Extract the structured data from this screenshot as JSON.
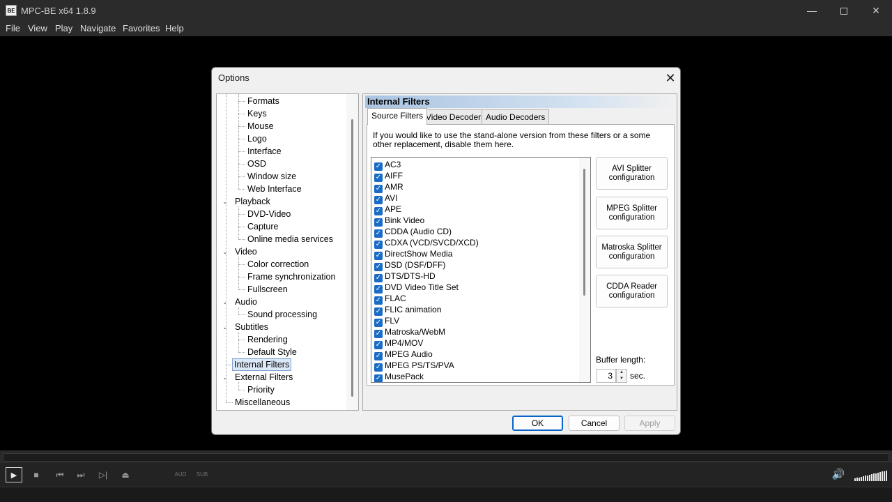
{
  "window": {
    "title": "MPC-BE x64 1.8.9",
    "icon_text": "BE",
    "minimize": "—",
    "close": "✕"
  },
  "menu": [
    "File",
    "View",
    "Play",
    "Navigate",
    "Favorites",
    "Help"
  ],
  "controls": {
    "aud_label": "AUD",
    "sub_label": "SUB",
    "icons": [
      "play-icon",
      "stop-icon",
      "previous-icon",
      "next-icon",
      "frame-step-icon",
      "eject-icon",
      "volume-icon"
    ],
    "volume_level": 1.0
  },
  "dialog": {
    "title": "Options",
    "close": "✕",
    "tree": [
      {
        "label": "Formats",
        "level": 1
      },
      {
        "label": "Keys",
        "level": 1
      },
      {
        "label": "Mouse",
        "level": 1
      },
      {
        "label": "Logo",
        "level": 1
      },
      {
        "label": "Interface",
        "level": 1
      },
      {
        "label": "OSD",
        "level": 1
      },
      {
        "label": "Window size",
        "level": 1
      },
      {
        "label": "Web Interface",
        "level": 1
      },
      {
        "label": "Playback",
        "level": 0,
        "expanded": true
      },
      {
        "label": "DVD-Video",
        "level": 1
      },
      {
        "label": "Capture",
        "level": 1
      },
      {
        "label": "Online media services",
        "level": 1
      },
      {
        "label": "Video",
        "level": 0,
        "expanded": true
      },
      {
        "label": "Color correction",
        "level": 1
      },
      {
        "label": "Frame synchronization",
        "level": 1
      },
      {
        "label": "Fullscreen",
        "level": 1
      },
      {
        "label": "Audio",
        "level": 0,
        "expanded": true
      },
      {
        "label": "Sound processing",
        "level": 1
      },
      {
        "label": "Subtitles",
        "level": 0,
        "expanded": true
      },
      {
        "label": "Rendering",
        "level": 1
      },
      {
        "label": "Default Style",
        "level": 1
      },
      {
        "label": "Internal Filters",
        "level": 0,
        "selected": true
      },
      {
        "label": "External Filters",
        "level": 0,
        "expanded": true
      },
      {
        "label": "Priority",
        "level": 1
      },
      {
        "label": "Miscellaneous",
        "level": 0
      }
    ],
    "panel": {
      "header": "Internal Filters",
      "tabs": [
        "Source Filters",
        "Video Decoders",
        "Audio Decoders"
      ],
      "active_tab": "Source Filters",
      "hint": "If you would like to use the stand-alone version from these filters or a some other replacement, disable them here.",
      "filters": [
        "AC3",
        "AIFF",
        "AMR",
        "AVI",
        "APE",
        "Bink Video",
        "CDDA (Audio CD)",
        "CDXA (VCD/SVCD/XCD)",
        "DirectShow Media",
        "DSD (DSF/DFF)",
        "DTS/DTS-HD",
        "DVD Video Title Set",
        "FLAC",
        "FLIC animation",
        "FLV",
        "Matroska/WebM",
        "MP4/MOV",
        "MPEG Audio",
        "MPEG PS/TS/PVA",
        "MusePack"
      ],
      "config_buttons": [
        "AVI Splitter configuration",
        "MPEG Splitter configuration",
        "Matroska Splitter configuration",
        "CDDA Reader configuration"
      ],
      "buffer_label": "Buffer length:",
      "buffer_value": "3",
      "buffer_unit": "sec."
    },
    "buttons": {
      "ok": "OK",
      "cancel": "Cancel",
      "apply": "Apply"
    }
  }
}
